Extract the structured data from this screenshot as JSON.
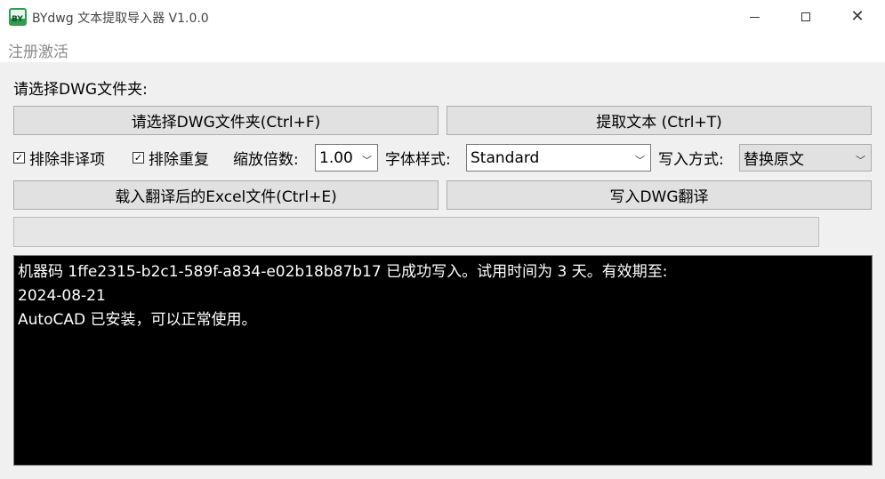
{
  "window": {
    "title": "BYdwg 文本提取导入器 V1.0.0",
    "icon_text": "BY"
  },
  "menu": {
    "items": [
      {
        "label": "注册激活"
      }
    ]
  },
  "main": {
    "select_folder_label": "请选择DWG文件夹:",
    "select_folder_button": "请选择DWG文件夹(Ctrl+F)",
    "extract_button": "提取文本 (Ctrl+T)",
    "exclude_non_translation": {
      "label": "排除非译项",
      "checked": true
    },
    "exclude_duplicates": {
      "label": "排除重复",
      "checked": true
    },
    "scale_label": "缩放倍数:",
    "scale_value": "1.00",
    "font_style_label": "字体样式:",
    "font_style_value": "Standard",
    "write_mode_label": "写入方式:",
    "write_mode_value": "替换原文",
    "load_excel_button": "载入翻译后的Excel文件(Ctrl+E)",
    "write_dwg_button": "写入DWG翻译",
    "progress": 0
  },
  "log": {
    "lines": [
      "机器码 1ffe2315-b2c1-589f-a834-e02b18b87b17 已成功写入。试用时间为 3 天。有效期至:",
      "2024-08-21",
      "AutoCAD 已安装，可以正常使用。"
    ]
  },
  "colors": {
    "console_bg": "#000000",
    "console_text": "#ffffff",
    "button_bg": "#e1e1e1",
    "window_bg": "#f0f0f0"
  },
  "icons": {
    "app": "bydwg-app-icon",
    "minimize": "minimize-icon",
    "maximize": "maximize-icon",
    "close": "close-icon",
    "dropdown": "chevron-down-icon",
    "checkbox": "checkbox-checked-icon"
  }
}
